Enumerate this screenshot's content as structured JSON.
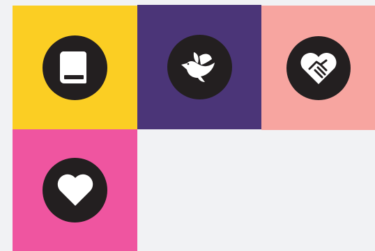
{
  "tiles": [
    {
      "id": "book",
      "icon": "book-icon",
      "color": "#fbce23"
    },
    {
      "id": "dove",
      "icon": "dove-icon",
      "color": "#4b3578"
    },
    {
      "id": "hands",
      "icon": "handshake-heart-icon",
      "color": "#f7a5a0"
    },
    {
      "id": "heart",
      "icon": "heart-icon",
      "color": "#ef55a0"
    }
  ],
  "colors": {
    "page_background": "#f1f2f4",
    "icon_disc": "#231f20",
    "icon_glyph": "#ffffff"
  }
}
